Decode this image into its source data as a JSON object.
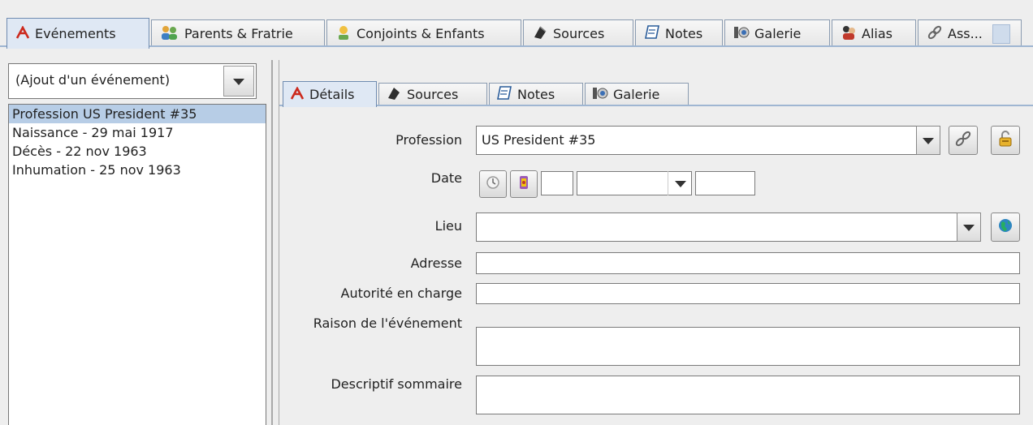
{
  "main_tabs": [
    {
      "label": "Evénements",
      "icon": "event-icon"
    },
    {
      "label": "Parents & Fratrie",
      "icon": "family-icon"
    },
    {
      "label": "Conjoints & Enfants",
      "icon": "spouse-icon"
    },
    {
      "label": "Sources",
      "icon": "source-icon"
    },
    {
      "label": "Notes",
      "icon": "note-icon"
    },
    {
      "label": "Galerie",
      "icon": "gallery-icon"
    },
    {
      "label": "Alias",
      "icon": "alias-icon"
    },
    {
      "label": "Ass...",
      "icon": "association-icon"
    }
  ],
  "add_event_combo": {
    "value": "(Ajout d'un événement)"
  },
  "events": [
    {
      "label": "Profession US President #35",
      "selected": true
    },
    {
      "label": "Naissance - 29 mai 1917",
      "selected": false
    },
    {
      "label": "Décès - 22 nov 1963",
      "selected": false
    },
    {
      "label": "Inhumation - 25 nov 1963",
      "selected": false
    }
  ],
  "sub_tabs": [
    {
      "label": "Détails",
      "icon": "event-icon"
    },
    {
      "label": "Sources",
      "icon": "source-icon"
    },
    {
      "label": "Notes",
      "icon": "note-icon"
    },
    {
      "label": "Galerie",
      "icon": "gallery-icon"
    }
  ],
  "form": {
    "profession_label": "Profession",
    "profession_value": "US President #35",
    "date_label": "Date",
    "date_day": "",
    "date_month": "",
    "date_year": "",
    "lieu_label": "Lieu",
    "lieu_value": "",
    "adresse_label": "Adresse",
    "adresse_value": "",
    "autorite_label": "Autorité en charge",
    "autorite_value": "",
    "raison_label": "Raison de l'événement",
    "raison_value": "",
    "descriptif_label": "Descriptif sommaire",
    "descriptif_value": ""
  },
  "colors": {
    "selected_row": "#b7cde6",
    "active_tab": "#dfe8f4",
    "event_icon": "#cc2a1e"
  }
}
